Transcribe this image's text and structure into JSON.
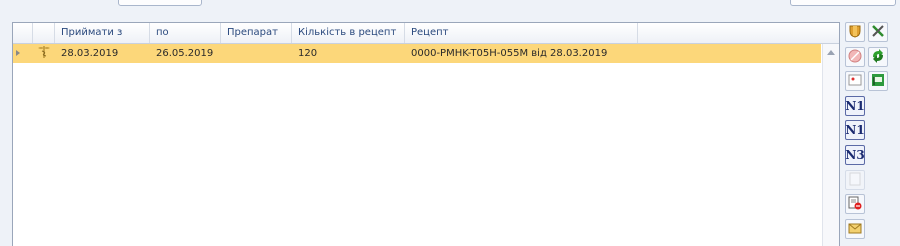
{
  "grid": {
    "columns": [
      "",
      "Приймати з",
      "по",
      "Препарат",
      "Кількість в рецепт",
      "Рецепт"
    ],
    "rows": [
      {
        "from": "28.03.2019",
        "to": "26.05.2019",
        "drug": "",
        "qty": "120",
        "recipe": "0000-PMHK-T05H-055M від 28.03.2019"
      }
    ]
  },
  "side_buttons": {
    "n1_a": "N1",
    "n1_b": "N1",
    "n3": "N3"
  },
  "icons": {
    "row_status": "caduceus-icon",
    "shield": "shield-icon",
    "tools": "tools-icon",
    "no_entry": "no-entry-icon",
    "refresh": "refresh-icon",
    "card": "card-icon",
    "flag": "flag-icon",
    "blank": "blank-page-icon",
    "doc_block": "document-block-icon",
    "mail": "mail-icon"
  },
  "colors": {
    "selected_row": "#fcd77a",
    "header_text": "#2b4a7e"
  }
}
